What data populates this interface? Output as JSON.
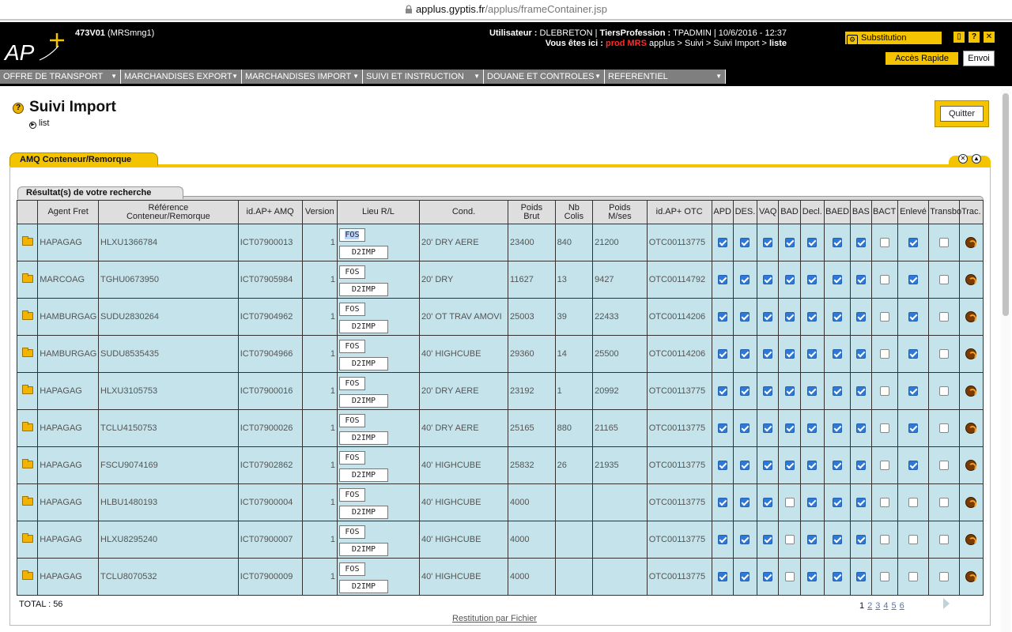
{
  "browser": {
    "host": "applus.gyptis.fr",
    "path": "/applus/frameContainer.jsp"
  },
  "header": {
    "code": "473V01",
    "code_sub": "(MRSmng1)",
    "user_label": "Utilisateur :",
    "user_value": "DLEBRETON",
    "tiers_label": "TiersProfession :",
    "tiers_value": "TPADMIN",
    "datetime": "10/6/2016 - 12:37",
    "location_label": "Vous êtes ici :",
    "location_env": "prod MRS",
    "location_path": "applus > Suivi > Suivi Import >",
    "location_current": "liste",
    "substitution": "Substitution",
    "acces_rapide": "Accès Rapide",
    "envoi": "Envoi"
  },
  "menu": [
    "OFFRE DE TRANSPORT",
    "MARCHANDISES EXPORT",
    "MARCHANDISES IMPORT",
    "SUIVI ET INSTRUCTION",
    "DOUANE ET CONTROLES",
    "REFERENTIEL"
  ],
  "page": {
    "title": "Suivi Import",
    "crumb": "list",
    "quit": "Quitter",
    "panel_title": "AMQ Conteneur/Remorque",
    "results_title": "Résultat(s) de votre recherche"
  },
  "table": {
    "headers": {
      "agent": "Agent Fret",
      "ref_1": "Référence",
      "ref_2": "Conteneur/Remorque",
      "idamq": "id.AP+ AMQ",
      "version": "Version",
      "lieu": "Lieu R/L",
      "cond": "Cond.",
      "poids_1": "Poids",
      "poids_2": "Brut",
      "colis_1": "Nb",
      "colis_2": "Colis",
      "pms_1": "Poids",
      "pms_2": "M/ses",
      "idotc": "id.AP+ OTC",
      "apd": "APD",
      "des": "DES.",
      "vaq": "VAQ",
      "bad": "BAD",
      "decl": "Decl.",
      "baed": "BAED",
      "bas": "BAS",
      "bact": "BACT",
      "enleve": "Enlevé",
      "transbo": "Transbo",
      "trac": "Trac."
    },
    "rows": [
      {
        "agent": "HAPAGAG",
        "ref": "HLXU1366784",
        "idamq": "ICT07900013",
        "version": "1",
        "lieu1": "FOS",
        "lieu2": "D2IMP",
        "cond": "20' DRY AERE",
        "poids": "23400",
        "colis": "840",
        "pms": "21200",
        "idotc": "OTC00113775",
        "flags": [
          1,
          1,
          1,
          1,
          1,
          1,
          1,
          0,
          1,
          0
        ]
      },
      {
        "agent": "MARCOAG",
        "ref": "TGHU0673950",
        "idamq": "ICT07905984",
        "version": "1",
        "lieu1": "FOS",
        "lieu2": "D2IMP",
        "cond": "20' DRY",
        "poids": "11627",
        "colis": "13",
        "pms": "9427",
        "idotc": "OTC00114792",
        "flags": [
          1,
          1,
          1,
          1,
          1,
          1,
          1,
          0,
          1,
          0
        ]
      },
      {
        "agent": "HAMBURGAG",
        "ref": "SUDU2830264",
        "idamq": "ICT07904962",
        "version": "1",
        "lieu1": "FOS",
        "lieu2": "D2IMP",
        "cond": "20' OT TRAV AMOVI",
        "poids": "25003",
        "colis": "39",
        "pms": "22433",
        "idotc": "OTC00114206",
        "flags": [
          1,
          1,
          1,
          1,
          1,
          1,
          1,
          0,
          1,
          0
        ]
      },
      {
        "agent": "HAMBURGAG",
        "ref": "SUDU8535435",
        "idamq": "ICT07904966",
        "version": "1",
        "lieu1": "FOS",
        "lieu2": "D2IMP",
        "cond": "40' HIGHCUBE",
        "poids": "29360",
        "colis": "14",
        "pms": "25500",
        "idotc": "OTC00114206",
        "flags": [
          1,
          1,
          1,
          1,
          1,
          1,
          1,
          0,
          1,
          0
        ]
      },
      {
        "agent": "HAPAGAG",
        "ref": "HLXU3105753",
        "idamq": "ICT07900016",
        "version": "1",
        "lieu1": "FOS",
        "lieu2": "D2IMP",
        "cond": "20' DRY AERE",
        "poids": "23192",
        "colis": "1",
        "pms": "20992",
        "idotc": "OTC00113775",
        "flags": [
          1,
          1,
          1,
          1,
          1,
          1,
          1,
          0,
          1,
          0
        ]
      },
      {
        "agent": "HAPAGAG",
        "ref": "TCLU4150753",
        "idamq": "ICT07900026",
        "version": "1",
        "lieu1": "FOS",
        "lieu2": "D2IMP",
        "cond": "40' DRY AERE",
        "poids": "25165",
        "colis": "880",
        "pms": "21165",
        "idotc": "OTC00113775",
        "flags": [
          1,
          1,
          1,
          1,
          1,
          1,
          1,
          0,
          1,
          0
        ]
      },
      {
        "agent": "HAPAGAG",
        "ref": "FSCU9074169",
        "idamq": "ICT07902862",
        "version": "1",
        "lieu1": "FOS",
        "lieu2": "D2IMP",
        "cond": "40' HIGHCUBE",
        "poids": "25832",
        "colis": "26",
        "pms": "21935",
        "idotc": "OTC00113775",
        "flags": [
          1,
          1,
          1,
          1,
          1,
          1,
          1,
          0,
          1,
          0
        ]
      },
      {
        "agent": "HAPAGAG",
        "ref": "HLBU1480193",
        "idamq": "ICT07900004",
        "version": "1",
        "lieu1": "FOS",
        "lieu2": "D2IMP",
        "cond": "40' HIGHCUBE",
        "poids": "4000",
        "colis": "",
        "pms": "",
        "idotc": "OTC00113775",
        "flags": [
          1,
          1,
          1,
          0,
          1,
          1,
          1,
          0,
          0,
          0
        ]
      },
      {
        "agent": "HAPAGAG",
        "ref": "HLXU8295240",
        "idamq": "ICT07900007",
        "version": "1",
        "lieu1": "FOS",
        "lieu2": "D2IMP",
        "cond": "40' HIGHCUBE",
        "poids": "4000",
        "colis": "",
        "pms": "",
        "idotc": "OTC00113775",
        "flags": [
          1,
          1,
          1,
          0,
          1,
          1,
          1,
          0,
          0,
          0
        ]
      },
      {
        "agent": "HAPAGAG",
        "ref": "TCLU8070532",
        "idamq": "ICT07900009",
        "version": "1",
        "lieu1": "FOS",
        "lieu2": "D2IMP",
        "cond": "40' HIGHCUBE",
        "poids": "4000",
        "colis": "",
        "pms": "",
        "idotc": "OTC00113775",
        "flags": [
          1,
          1,
          1,
          0,
          1,
          1,
          1,
          0,
          0,
          0
        ]
      }
    ]
  },
  "footer": {
    "total": "TOTAL : 56",
    "pages": [
      "1",
      "2",
      "3",
      "4",
      "5",
      "6"
    ],
    "current_page": "1",
    "restitution": "Restitution par Fichier"
  },
  "colors": {
    "accent": "#f5c400",
    "row_bg": "#c4e3ea",
    "checkbox_on": "#2f78d6"
  }
}
